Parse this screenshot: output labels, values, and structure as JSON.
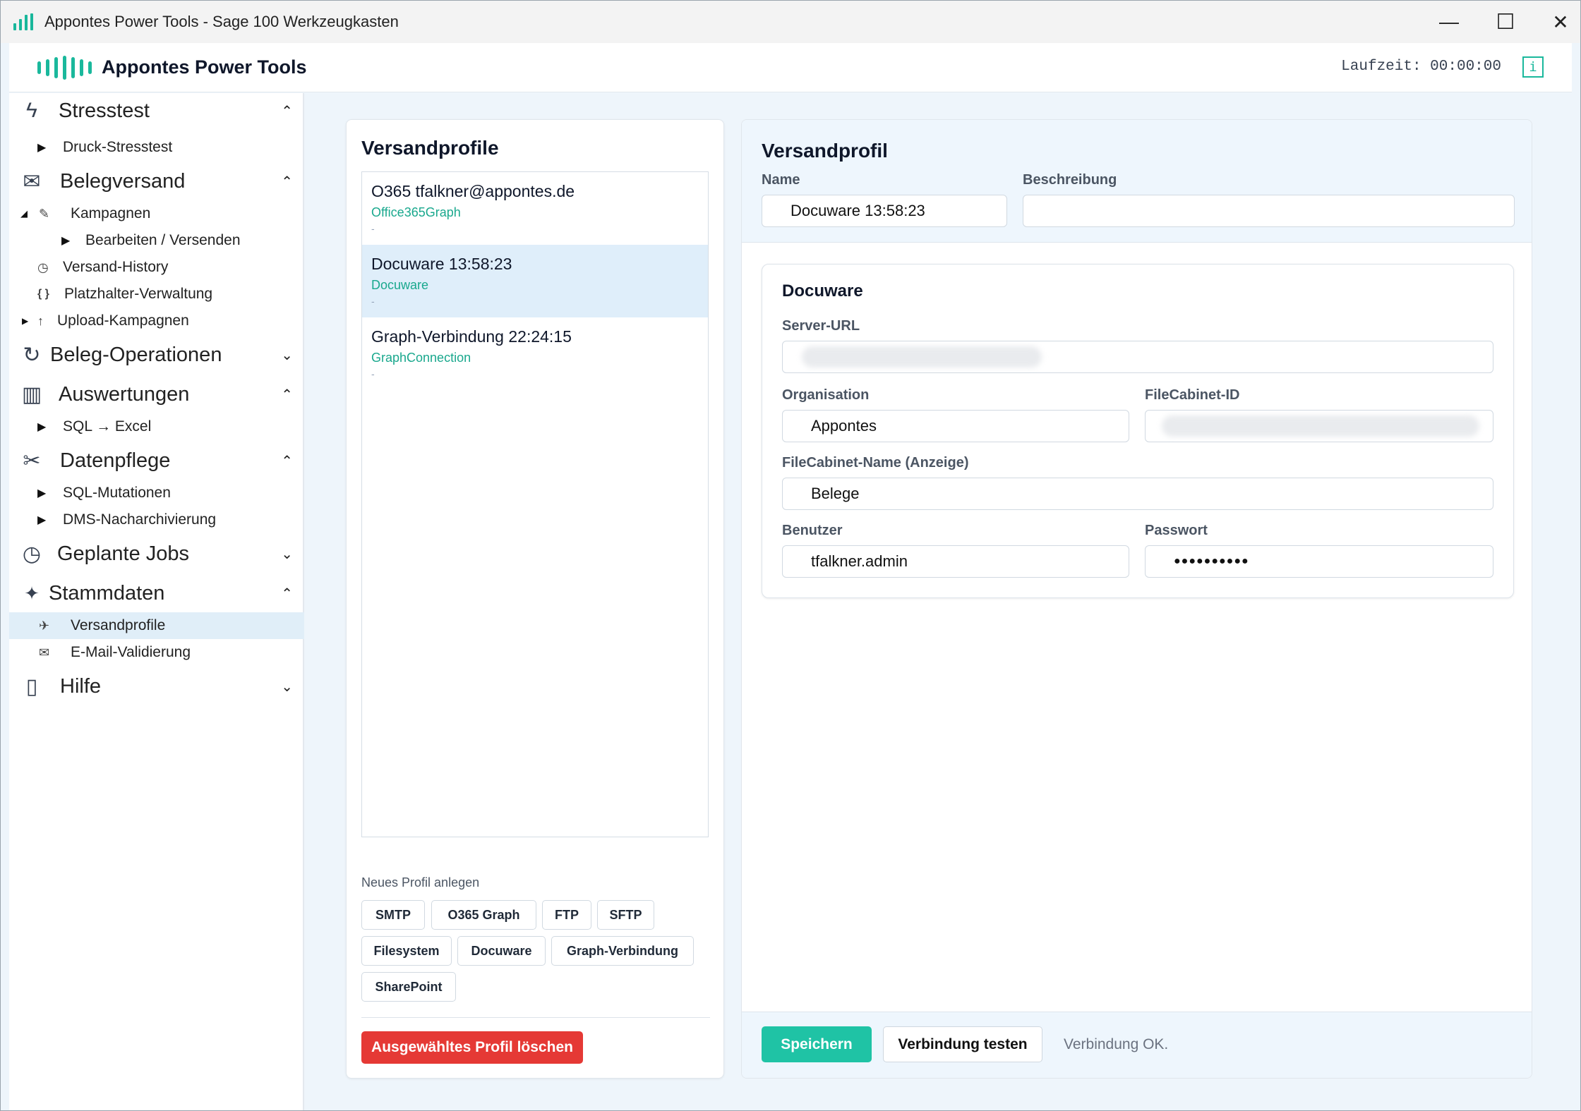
{
  "window": {
    "title": "Appontes Power Tools - Sage 100 Werkzeugkasten",
    "minimize": "—",
    "maximize": "☐",
    "close": "✕"
  },
  "header": {
    "brand": "Appontes Power Tools",
    "runtime": "Laufzeit: 00:00:00",
    "info": "i"
  },
  "sidebar": {
    "sections": [
      {
        "label": "Stresstest",
        "icon": "lightning-icon",
        "glyph": "ϟ",
        "chevron": "⌃"
      },
      {
        "label": "Belegversand",
        "icon": "envelope-icon",
        "glyph": "✉",
        "chevron": "⌃"
      },
      {
        "label": "Beleg-Operationen",
        "icon": "refresh-icon",
        "glyph": "↻",
        "chevron": "⌄"
      },
      {
        "label": "Auswertungen",
        "icon": "bar-chart-icon",
        "glyph": "▥",
        "chevron": "⌃"
      },
      {
        "label": "Datenpflege",
        "icon": "tools-icon",
        "glyph": "✂",
        "chevron": "⌃"
      },
      {
        "label": "Geplante Jobs",
        "icon": "stopwatch-icon",
        "glyph": "◷",
        "chevron": "⌄"
      },
      {
        "label": "Stammdaten",
        "icon": "sparkle-icon",
        "glyph": "✦",
        "chevron": "⌃"
      },
      {
        "label": "Hilfe",
        "icon": "book-icon",
        "glyph": "▯",
        "chevron": "⌄"
      }
    ],
    "items": [
      {
        "label": "Druck-Stresstest"
      },
      {
        "label": "Kampagnen",
        "glyph": "✎"
      },
      {
        "label": "Bearbeiten / Versenden"
      },
      {
        "label": "Versand-History",
        "glyph": "◷"
      },
      {
        "label": "Platzhalter-Verwaltung",
        "glyph": "{ }"
      },
      {
        "label": "Upload-Kampagnen",
        "glyph": "↑"
      },
      {
        "label": "SQL → Excel"
      },
      {
        "label": "SQL-Mutationen"
      },
      {
        "label": "DMS-Nacharchivierung"
      },
      {
        "label": "Versandprofile",
        "glyph": "✈"
      },
      {
        "label": "E-Mail-Validierung",
        "glyph": "✉"
      }
    ]
  },
  "profiles_panel": {
    "title": "Versandprofile",
    "profiles": [
      {
        "name": "O365 tfalkner@appontes.de",
        "type": "Office365Graph",
        "desc": "-"
      },
      {
        "name": "Docuware 13:58:23",
        "type": "Docuware",
        "desc": "-"
      },
      {
        "name": "Graph-Verbindung 22:24:15",
        "type": "GraphConnection",
        "desc": "-"
      }
    ],
    "new_label": "Neues Profil anlegen",
    "new_buttons": [
      "SMTP",
      "O365 Graph",
      "FTP",
      "SFTP",
      "Filesystem",
      "Docuware",
      "Graph-Verbindung",
      "SharePoint"
    ],
    "delete_label": "Ausgewähltes Profil löschen"
  },
  "detail": {
    "title": "Versandprofil",
    "name_label": "Name",
    "name_value": "Docuware 13:58:23",
    "desc_label": "Beschreibung",
    "desc_value": "",
    "card": {
      "title": "Docuware",
      "server_label": "Server-URL",
      "server_value": "",
      "org_label": "Organisation",
      "org_value": "Appontes",
      "fcid_label": "FileCabinet-ID",
      "fcid_value": "",
      "fcname_label": "FileCabinet-Name (Anzeige)",
      "fcname_value": "Belege",
      "user_label": "Benutzer",
      "user_value": "tfalkner.admin",
      "pass_label": "Passwort",
      "pass_value": "●●●●●●●●●●"
    },
    "save_label": "Speichern",
    "test_label": "Verbindung testen",
    "status": "Verbindung OK."
  },
  "colors": {
    "accent": "#1ab89c",
    "danger": "#e53935",
    "selection": "#dfeefa"
  }
}
